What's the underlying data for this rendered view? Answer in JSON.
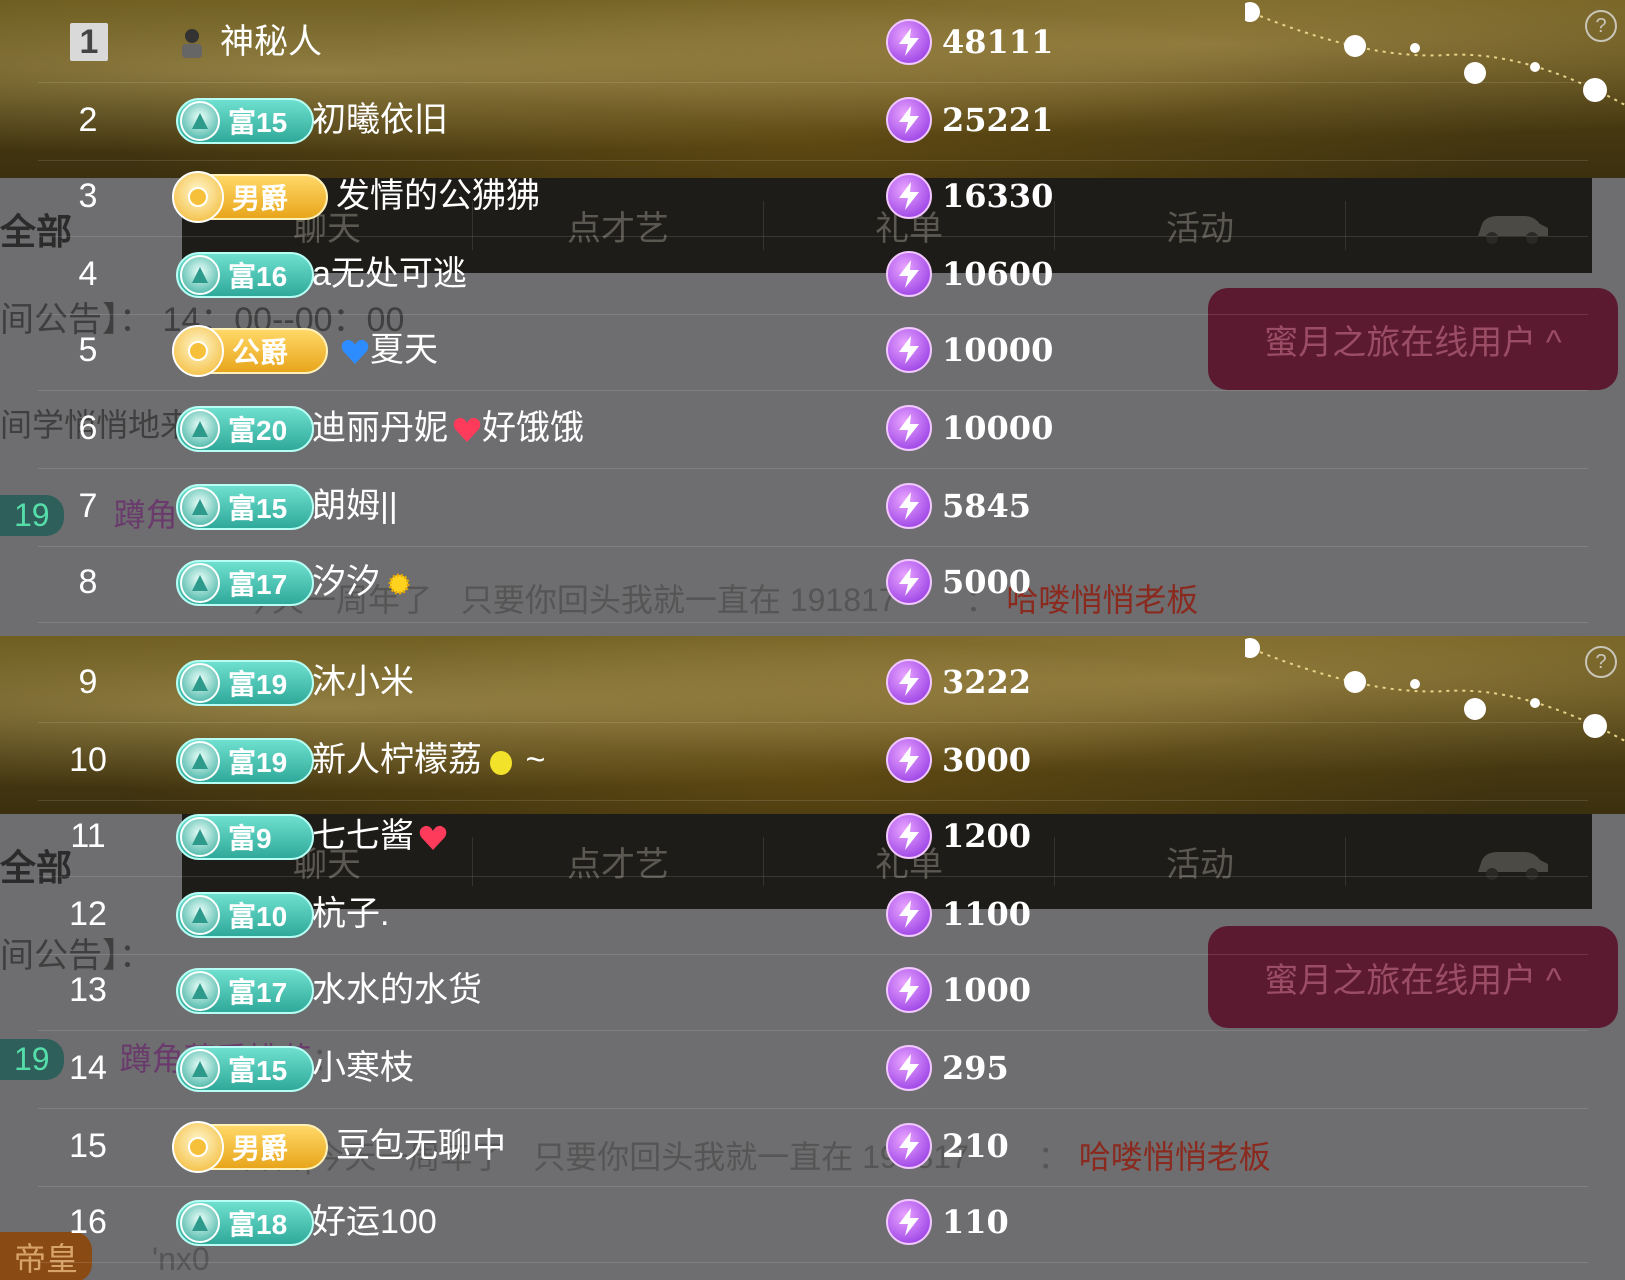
{
  "panels": [
    {
      "tabs": [
        "聊天",
        "点才艺",
        "礼单",
        "活动"
      ],
      "all_label": "全部",
      "notice": "间公告】： 14：00--00：00",
      "notice2": "间学悄悄地来了",
      "online_button": "蜜月之旅在线用户 ^",
      "chat1": {
        "level": "19",
        "name": "蹲角"
      },
      "chat2": {
        "text": "今天一周年了",
        "middle": "只要你回头我就一直在",
        "tag": "191817",
        "sep": "：",
        "boss": "哈喽悄悄老板"
      }
    },
    {
      "tabs": [
        "聊天",
        "点才艺",
        "礼单",
        "活动"
      ],
      "all_label": "全部",
      "notice": "间公告】：",
      "online_button": "蜜月之旅在线用户 ^",
      "chat1": {
        "level": "19",
        "name": "蹲角落看桃花",
        "sep": "："
      },
      "chat2": {
        "text": "喜喜|今天一周年了",
        "middle": "只要你回头我就一直在",
        "tag": "191817",
        "sep": "：",
        "boss": "哈喽悄悄老板"
      },
      "chat3": {
        "text": "帝皇",
        "name": "'nx0"
      }
    }
  ],
  "ranking": [
    {
      "rank": "1",
      "badge": null,
      "name": "神秘人",
      "score": "48111"
    },
    {
      "rank": "2",
      "badge": {
        "type": "rich",
        "label": "富15"
      },
      "name": "初曦依旧",
      "score": "25221"
    },
    {
      "rank": "3",
      "badge": {
        "type": "gold",
        "label": "男爵"
      },
      "name": "发情的公狒狒",
      "score": "16330"
    },
    {
      "rank": "4",
      "badge": {
        "type": "rich",
        "label": "富16"
      },
      "name": "a无处可逃",
      "score": "10600"
    },
    {
      "rank": "5",
      "badge": {
        "type": "gold",
        "label": "公爵"
      },
      "name": "夏天",
      "score": "10000",
      "emoji_before": "blue-heart"
    },
    {
      "rank": "6",
      "badge": {
        "type": "rich",
        "label": "富20"
      },
      "name": "迪丽丹妮",
      "name2": "好饿饿",
      "score": "10000",
      "emoji_mid": "red-heart"
    },
    {
      "rank": "7",
      "badge": {
        "type": "rich",
        "label": "富15"
      },
      "name": "朗姆||",
      "score": "5845"
    },
    {
      "rank": "8",
      "badge": {
        "type": "rich",
        "label": "富17"
      },
      "name": "汐汐",
      "score": "5000",
      "emoji_after": "sun"
    },
    {
      "rank": "9",
      "badge": {
        "type": "rich",
        "label": "富19"
      },
      "name": "沐小米",
      "score": "3222"
    },
    {
      "rank": "10",
      "badge": {
        "type": "rich",
        "label": "富19"
      },
      "name": "新人柠檬荔",
      "name_suffix": "~",
      "score": "3000",
      "emoji_after": "lemon"
    },
    {
      "rank": "11",
      "badge": {
        "type": "rich",
        "label": "富9"
      },
      "name": "七七酱",
      "score": "1200",
      "emoji_after": "red-heart"
    },
    {
      "rank": "12",
      "badge": {
        "type": "rich",
        "label": "富10"
      },
      "name": "杭子.",
      "score": "1100"
    },
    {
      "rank": "13",
      "badge": {
        "type": "rich",
        "label": "富17"
      },
      "name": "水水的水货",
      "score": "1000"
    },
    {
      "rank": "14",
      "badge": {
        "type": "rich",
        "label": "富15"
      },
      "name": "小寒枝",
      "score": "295"
    },
    {
      "rank": "15",
      "badge": {
        "type": "gold",
        "label": "男爵"
      },
      "name": "豆包无聊中",
      "score": "210"
    },
    {
      "rank": "16",
      "badge": {
        "type": "rich",
        "label": "富18"
      },
      "name": "好运100",
      "score": "110"
    }
  ]
}
